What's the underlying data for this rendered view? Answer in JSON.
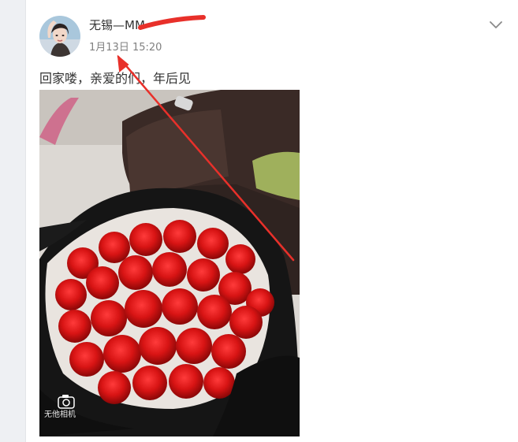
{
  "post": {
    "username": "无锡—MM",
    "timestamp": "1月13日 15:20",
    "text": "回家喽，亲爱的们，年后见"
  },
  "photo": {
    "watermark_text": "无他相机",
    "subject": "bouquet of red roses",
    "watermark_icon": "camera-icon"
  },
  "icons": {
    "menu": "chevron-down-icon",
    "annotation": "red-arrow-annotation"
  },
  "colors": {
    "annotation": "#e8302a",
    "text": "#333333",
    "meta": "#808080"
  }
}
